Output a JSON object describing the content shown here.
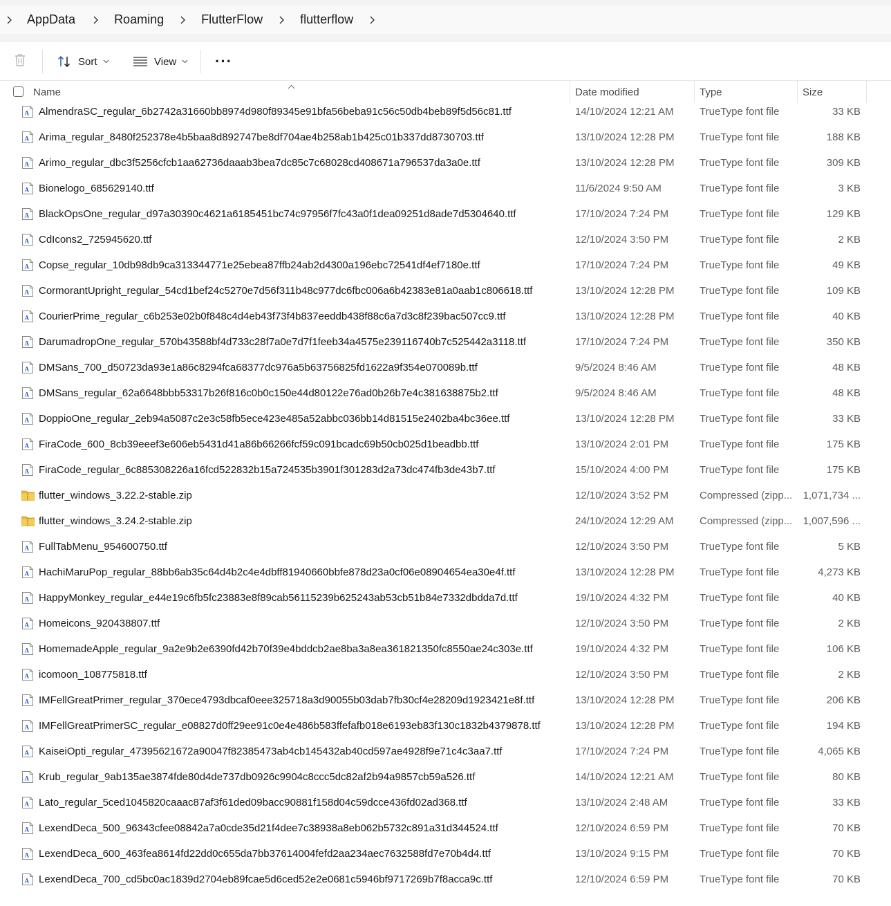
{
  "breadcrumb": [
    "AppData",
    "Roaming",
    "FlutterFlow",
    "flutterflow"
  ],
  "toolbar": {
    "sort_label": "Sort",
    "view_label": "View",
    "more_label": "···"
  },
  "columns": {
    "name": "Name",
    "date": "Date modified",
    "type": "Type",
    "size": "Size"
  },
  "files": [
    {
      "name": "AlmendraSC_regular_6b2742a31660bb8974d980f89345e91bfa56beba91c56c50db4beb89f5d56c81.ttf",
      "date": "14/10/2024 12:21 AM",
      "type": "TrueType font file",
      "size": "33 KB",
      "icon": "font-file-icon"
    },
    {
      "name": "Arima_regular_8480f252378e4b5baa8d892747be8df704ae4b258ab1b425c01b337dd8730703.ttf",
      "date": "13/10/2024 12:28 PM",
      "type": "TrueType font file",
      "size": "188 KB",
      "icon": "font-file-icon"
    },
    {
      "name": "Arimo_regular_dbc3f5256cfcb1aa62736daaab3bea7dc85c7c68028cd408671a796537da3a0e.ttf",
      "date": "13/10/2024 12:28 PM",
      "type": "TrueType font file",
      "size": "309 KB",
      "icon": "font-file-icon"
    },
    {
      "name": "Bionelogo_685629140.ttf",
      "date": "11/6/2024 9:50 AM",
      "type": "TrueType font file",
      "size": "3 KB",
      "icon": "font-file-icon"
    },
    {
      "name": "BlackOpsOne_regular_d97a30390c4621a6185451bc74c97956f7fc43a0f1dea09251d8ade7d5304640.ttf",
      "date": "17/10/2024 7:24 PM",
      "type": "TrueType font file",
      "size": "129 KB",
      "icon": "font-file-icon"
    },
    {
      "name": "CdIcons2_725945620.ttf",
      "date": "12/10/2024 3:50 PM",
      "type": "TrueType font file",
      "size": "2 KB",
      "icon": "font-file-icon"
    },
    {
      "name": "Copse_regular_10db98db9ca313344771e25ebea87ffb24ab2d4300a196ebc72541df4ef7180e.ttf",
      "date": "17/10/2024 7:24 PM",
      "type": "TrueType font file",
      "size": "49 KB",
      "icon": "font-file-icon"
    },
    {
      "name": "CormorantUpright_regular_54cd1bef24c5270e7d56f311b48c977dc6fbc006a6b42383e81a0aab1c806618.ttf",
      "date": "13/10/2024 12:28 PM",
      "type": "TrueType font file",
      "size": "109 KB",
      "icon": "font-file-icon"
    },
    {
      "name": "CourierPrime_regular_c6b253e02b0f848c4d4eb43f73f4b837eeddb438f88c6a7d3c8f239bac507cc9.ttf",
      "date": "13/10/2024 12:28 PM",
      "type": "TrueType font file",
      "size": "40 KB",
      "icon": "font-file-icon"
    },
    {
      "name": "DarumadropOne_regular_570b43588bf4d733c28f7a0e7d7f1feeb34a4575e239116740b7c525442a3118.ttf",
      "date": "17/10/2024 7:24 PM",
      "type": "TrueType font file",
      "size": "350 KB",
      "icon": "font-file-icon"
    },
    {
      "name": "DMSans_700_d50723da93e1a86c8294fca68377dc976a5b63756825fd1622a9f354e070089b.ttf",
      "date": "9/5/2024 8:46 AM",
      "type": "TrueType font file",
      "size": "48 KB",
      "icon": "font-file-icon"
    },
    {
      "name": "DMSans_regular_62a6648bbb53317b26f816c0b0c150e44d80122e76ad0b26b7e4c381638875b2.ttf",
      "date": "9/5/2024 8:46 AM",
      "type": "TrueType font file",
      "size": "48 KB",
      "icon": "font-file-icon"
    },
    {
      "name": "DoppioOne_regular_2eb94a5087c2e3c58fb5ece423e485a52abbc036bb14d81515e2402ba4bc36ee.ttf",
      "date": "13/10/2024 12:28 PM",
      "type": "TrueType font file",
      "size": "33 KB",
      "icon": "font-file-icon"
    },
    {
      "name": "FiraCode_600_8cb39eeef3e606eb5431d41a86b66266fcf59c091bcadc69b50cb025d1beadbb.ttf",
      "date": "13/10/2024 2:01 PM",
      "type": "TrueType font file",
      "size": "175 KB",
      "icon": "font-file-icon"
    },
    {
      "name": "FiraCode_regular_6c885308226a16fcd522832b15a724535b3901f301283d2a73dc474fb3de43b7.ttf",
      "date": "15/10/2024 4:00 PM",
      "type": "TrueType font file",
      "size": "175 KB",
      "icon": "font-file-icon"
    },
    {
      "name": "flutter_windows_3.22.2-stable.zip",
      "date": "12/10/2024 3:52 PM",
      "type": "Compressed (zipp...",
      "size": "1,071,734 ...",
      "icon": "zip-folder-icon"
    },
    {
      "name": "flutter_windows_3.24.2-stable.zip",
      "date": "24/10/2024 12:29 AM",
      "type": "Compressed (zipp...",
      "size": "1,007,596 ...",
      "icon": "zip-folder-icon"
    },
    {
      "name": "FullTabMenu_954600750.ttf",
      "date": "12/10/2024 3:50 PM",
      "type": "TrueType font file",
      "size": "5 KB",
      "icon": "font-file-icon"
    },
    {
      "name": "HachiMaruPop_regular_88bb6ab35c64d4b2c4e4dbff81940660bbfe878d23a0cf06e08904654ea30e4f.ttf",
      "date": "13/10/2024 12:28 PM",
      "type": "TrueType font file",
      "size": "4,273 KB",
      "icon": "font-file-icon"
    },
    {
      "name": "HappyMonkey_regular_e44e19c6fb5fc23883e8f89cab56115239b625243ab53cb51b84e7332dbdda7d.ttf",
      "date": "19/10/2024 4:32 PM",
      "type": "TrueType font file",
      "size": "40 KB",
      "icon": "font-file-icon"
    },
    {
      "name": "Homeicons_920438807.ttf",
      "date": "12/10/2024 3:50 PM",
      "type": "TrueType font file",
      "size": "2 KB",
      "icon": "font-file-icon"
    },
    {
      "name": "HomemadeApple_regular_9a2e9b2e6390fd42b70f39e4bddcb2ae8ba3a8ea361821350fc8550ae24c303e.ttf",
      "date": "19/10/2024 4:32 PM",
      "type": "TrueType font file",
      "size": "106 KB",
      "icon": "font-file-icon"
    },
    {
      "name": "icomoon_108775818.ttf",
      "date": "12/10/2024 3:50 PM",
      "type": "TrueType font file",
      "size": "2 KB",
      "icon": "font-file-icon"
    },
    {
      "name": "IMFellGreatPrimer_regular_370ece4793dbcaf0eee325718a3d90055b03dab7fb30cf4e28209d1923421e8f.ttf",
      "date": "13/10/2024 12:28 PM",
      "type": "TrueType font file",
      "size": "206 KB",
      "icon": "font-file-icon"
    },
    {
      "name": "IMFellGreatPrimerSC_regular_e08827d0ff29ee91c0e4e486b583ffefafb018e6193eb83f130c1832b4379878.ttf",
      "date": "13/10/2024 12:28 PM",
      "type": "TrueType font file",
      "size": "194 KB",
      "icon": "font-file-icon"
    },
    {
      "name": "KaiseiOpti_regular_47395621672a90047f82385473ab4cb145432ab40cd597ae4928f9e71c4c3aa7.ttf",
      "date": "17/10/2024 7:24 PM",
      "type": "TrueType font file",
      "size": "4,065 KB",
      "icon": "font-file-icon"
    },
    {
      "name": "Krub_regular_9ab135ae3874fde80d4de737db0926c9904c8ccc5dc82af2b94a9857cb59a526.ttf",
      "date": "14/10/2024 12:21 AM",
      "type": "TrueType font file",
      "size": "80 KB",
      "icon": "font-file-icon"
    },
    {
      "name": "Lato_regular_5ced1045820caaac87af3f61ded09bacc90881f158d04c59dcce436fd02ad368.ttf",
      "date": "13/10/2024 2:48 AM",
      "type": "TrueType font file",
      "size": "33 KB",
      "icon": "font-file-icon"
    },
    {
      "name": "LexendDeca_500_96343cfee08842a7a0cde35d21f4dee7c38938a8eb062b5732c891a31d344524.ttf",
      "date": "12/10/2024 6:59 PM",
      "type": "TrueType font file",
      "size": "70 KB",
      "icon": "font-file-icon"
    },
    {
      "name": "LexendDeca_600_463fea8614fd22dd0c655da7bb37614004fefd2aa234aec7632588fd7e70b4d4.ttf",
      "date": "13/10/2024 9:15 PM",
      "type": "TrueType font file",
      "size": "70 KB",
      "icon": "font-file-icon"
    },
    {
      "name": "LexendDeca_700_cd5bc0ac1839d2704eb89fcae5d6ced52e2e0681c5946bf9717269b7f8acca9c.ttf",
      "date": "12/10/2024 6:59 PM",
      "type": "TrueType font file",
      "size": "70 KB",
      "icon": "font-file-icon"
    }
  ]
}
